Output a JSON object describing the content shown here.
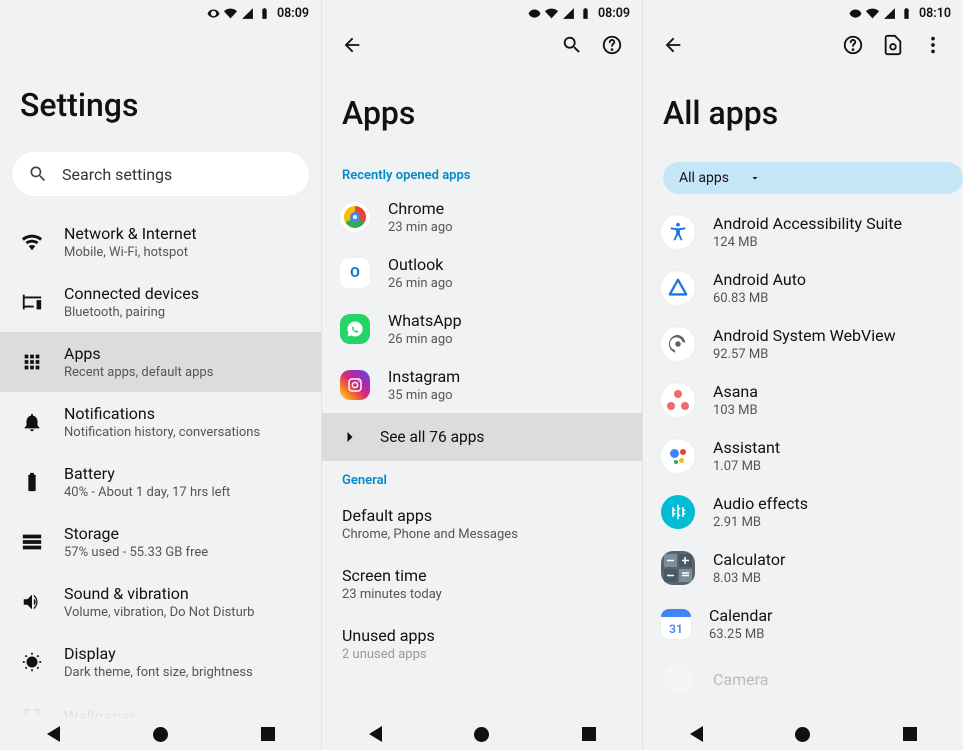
{
  "pane1": {
    "status_time": "08:09",
    "title": "Settings",
    "search_placeholder": "Search settings",
    "items": [
      {
        "t": "Network & Internet",
        "s": "Mobile, Wi-Fi, hotspot"
      },
      {
        "t": "Connected devices",
        "s": "Bluetooth, pairing"
      },
      {
        "t": "Apps",
        "s": "Recent apps, default apps"
      },
      {
        "t": "Notifications",
        "s": "Notification history, conversations"
      },
      {
        "t": "Battery",
        "s": "40% - About 1 day, 17 hrs left"
      },
      {
        "t": "Storage",
        "s": "57% used - 55.33 GB free"
      },
      {
        "t": "Sound & vibration",
        "s": "Volume, vibration, Do Not Disturb"
      },
      {
        "t": "Display",
        "s": "Dark theme, font size, brightness"
      },
      {
        "t": "Wallpaper",
        "s": ""
      }
    ]
  },
  "pane2": {
    "status_time": "08:09",
    "title": "Apps",
    "section_recent": "Recently opened apps",
    "section_general": "General",
    "recent": [
      {
        "t": "Chrome",
        "s": "23 min ago"
      },
      {
        "t": "Outlook",
        "s": "26 min ago"
      },
      {
        "t": "WhatsApp",
        "s": "26 min ago"
      },
      {
        "t": "Instagram",
        "s": "35 min ago"
      }
    ],
    "see_all": "See all 76 apps",
    "general": [
      {
        "t": "Default apps",
        "s": "Chrome, Phone and Messages"
      },
      {
        "t": "Screen time",
        "s": "23 minutes today"
      },
      {
        "t": "Unused apps",
        "s": "2 unused apps"
      }
    ]
  },
  "pane3": {
    "status_time": "08:10",
    "title": "All apps",
    "filter_label": "All apps",
    "apps": [
      {
        "t": "Android Accessibility Suite",
        "s": "124 MB"
      },
      {
        "t": "Android Auto",
        "s": "60.83 MB"
      },
      {
        "t": "Android System WebView",
        "s": "92.57 MB"
      },
      {
        "t": "Asana",
        "s": "103 MB"
      },
      {
        "t": "Assistant",
        "s": "1.07 MB"
      },
      {
        "t": "Audio effects",
        "s": "2.91 MB"
      },
      {
        "t": "Calculator",
        "s": "8.03 MB"
      },
      {
        "t": "Calendar",
        "s": "63.25 MB"
      }
    ],
    "next_faded": "Camera"
  }
}
